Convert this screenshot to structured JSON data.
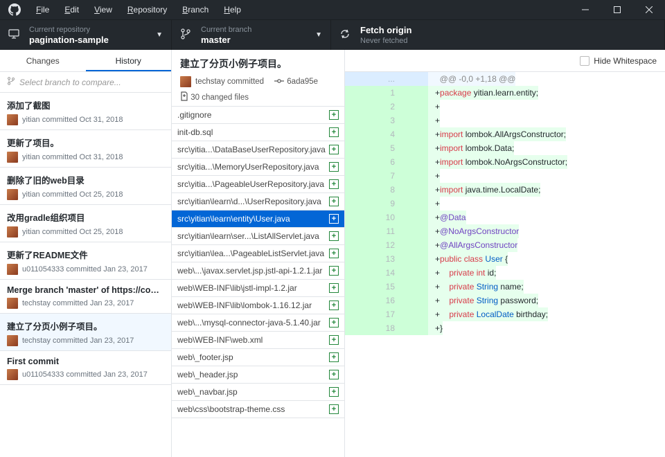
{
  "menu": [
    "File",
    "Edit",
    "View",
    "Repository",
    "Branch",
    "Help"
  ],
  "top": {
    "repoLabel": "Current repository",
    "repoValue": "pagination-sample",
    "branchLabel": "Current branch",
    "branchValue": "master",
    "fetchLabel": "Fetch origin",
    "fetchSub": "Never fetched"
  },
  "tabs": {
    "changes": "Changes",
    "history": "History"
  },
  "branchCompare": "Select branch to compare...",
  "commits": [
    {
      "title": "添加了截图",
      "meta": "yitian committed Oct 31, 2018",
      "sel": false
    },
    {
      "title": "更新了项目。",
      "meta": "yitian committed Oct 31, 2018",
      "sel": false
    },
    {
      "title": "删除了旧的web目录",
      "meta": "yitian committed Oct 25, 2018",
      "sel": false
    },
    {
      "title": "改用gradle组织项目",
      "meta": "yitian committed Oct 25, 2018",
      "sel": false
    },
    {
      "title": "更新了README文件",
      "meta": "u011054333 committed Jan 23, 2017",
      "sel": false
    },
    {
      "title": "Merge branch 'master' of https://code.c…",
      "meta": "techstay committed Jan 23, 2017",
      "sel": false
    },
    {
      "title": "建立了分页小例子项目。",
      "meta": "techstay committed Jan 23, 2017",
      "sel": true
    },
    {
      "title": "First commit",
      "meta": "u011054333 committed Jan 23, 2017",
      "sel": false
    }
  ],
  "commitHeader": {
    "title": "建立了分页小例子项目。",
    "author": "techstay committed",
    "sha": "6ada95e",
    "changed": "30 changed files"
  },
  "hideWs": "Hide Whitespace",
  "files": [
    {
      "n": ".gitignore",
      "sel": false
    },
    {
      "n": "init-db.sql",
      "sel": false
    },
    {
      "n": "src\\yitia...\\DataBaseUserRepository.java",
      "sel": false
    },
    {
      "n": "src\\yitia...\\MemoryUserRepository.java",
      "sel": false
    },
    {
      "n": "src\\yitia...\\PageableUserRepository.java",
      "sel": false
    },
    {
      "n": "src\\yitian\\learn\\d...\\UserRepository.java",
      "sel": false
    },
    {
      "n": "src\\yitian\\learn\\entity\\User.java",
      "sel": true
    },
    {
      "n": "src\\yitian\\learn\\ser...\\ListAllServlet.java",
      "sel": false
    },
    {
      "n": "src\\yitian\\lea...\\PageableListServlet.java",
      "sel": false
    },
    {
      "n": "web\\...\\javax.servlet.jsp.jstl-api-1.2.1.jar",
      "sel": false
    },
    {
      "n": "web\\WEB-INF\\lib\\jstl-impl-1.2.jar",
      "sel": false
    },
    {
      "n": "web\\WEB-INF\\lib\\lombok-1.16.12.jar",
      "sel": false
    },
    {
      "n": "web\\...\\mysql-connector-java-5.1.40.jar",
      "sel": false
    },
    {
      "n": "web\\WEB-INF\\web.xml",
      "sel": false
    },
    {
      "n": "web\\_footer.jsp",
      "sel": false
    },
    {
      "n": "web\\_header.jsp",
      "sel": false
    },
    {
      "n": "web\\_navbar.jsp",
      "sel": false
    },
    {
      "n": "web\\css\\bootstrap-theme.css",
      "sel": false
    }
  ],
  "diff": {
    "hunk": "@@ -0,0 +1,18 @@",
    "lines": [
      {
        "n": 1,
        "html": "+<span class='tk-k'>package</span> yitian.learn.entity;"
      },
      {
        "n": 2,
        "html": "+"
      },
      {
        "n": 3,
        "html": "+"
      },
      {
        "n": 4,
        "html": "+<span class='tk-k'>import</span> lombok.AllArgsConstructor;"
      },
      {
        "n": 5,
        "html": "+<span class='tk-k'>import</span> lombok.Data;"
      },
      {
        "n": 6,
        "html": "+<span class='tk-k'>import</span> lombok.NoArgsConstructor;"
      },
      {
        "n": 7,
        "html": "+"
      },
      {
        "n": 8,
        "html": "+<span class='tk-k'>import</span> java.time.LocalDate;"
      },
      {
        "n": 9,
        "html": "+"
      },
      {
        "n": 10,
        "html": "+<span class='tk-s'>@Data</span>"
      },
      {
        "n": 11,
        "html": "+<span class='tk-s'>@NoArgsConstructor</span>"
      },
      {
        "n": 12,
        "html": "+<span class='tk-s'>@AllArgsConstructor</span>"
      },
      {
        "n": 13,
        "html": "+<span class='tk-k'>public</span> <span class='tk-k'>class</span> <span class='tk-t'>User</span> {"
      },
      {
        "n": 14,
        "html": "+    <span class='tk-k'>private</span> <span class='tk-k'>int</span> id;"
      },
      {
        "n": 15,
        "html": "+    <span class='tk-k'>private</span> <span class='tk-t'>String</span> name;"
      },
      {
        "n": 16,
        "html": "+    <span class='tk-k'>private</span> <span class='tk-t'>String</span> password;"
      },
      {
        "n": 17,
        "html": "+    <span class='tk-k'>private</span> <span class='tk-t'>LocalDate</span> birthday;"
      },
      {
        "n": 18,
        "html": "+}"
      }
    ]
  }
}
